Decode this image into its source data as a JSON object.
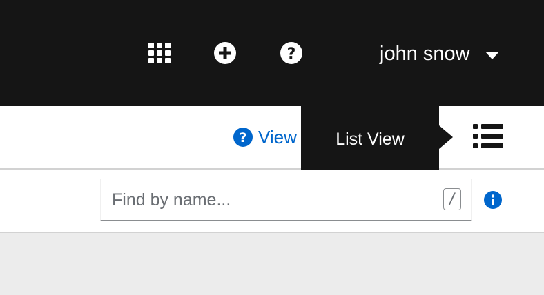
{
  "masthead": {
    "icons": [
      "app-launcher-icon",
      "plus-circle-icon",
      "question-circle-icon"
    ],
    "user_name": "john snow",
    "background_color": "#151515"
  },
  "toolbar": {
    "view_link_label": "View",
    "tooltip_text": "List View",
    "link_color": "#0066cc"
  },
  "filter": {
    "search_placeholder": "Find by name...",
    "shortcut_key": "/"
  }
}
